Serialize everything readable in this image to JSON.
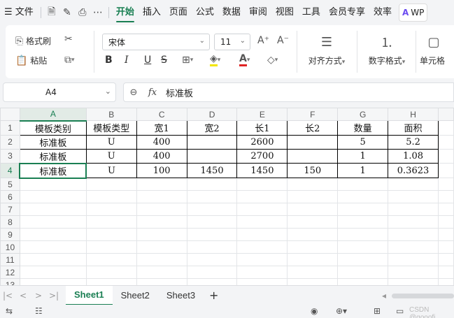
{
  "menu": {
    "file_label": "文件",
    "tabs": [
      "开始",
      "插入",
      "页面",
      "公式",
      "数据",
      "审阅",
      "视图",
      "工具",
      "会员专享",
      "效率"
    ],
    "active_tab": "开始",
    "wps_label": "WP"
  },
  "ribbon": {
    "format_painter": "格式刷",
    "paste": "粘贴",
    "font_name": "宋体",
    "font_size": "11",
    "align_label": "对齐方式",
    "number_label": "数字格式",
    "cell_label": "单元格"
  },
  "formula_bar": {
    "cell_ref": "A4",
    "fx": "fx",
    "value": "标准板"
  },
  "grid": {
    "columns": [
      "A",
      "B",
      "C",
      "D",
      "E",
      "F",
      "G",
      "H"
    ],
    "selected_column": "A",
    "selected_row": "4",
    "row_numbers": [
      "1",
      "2",
      "3",
      "4",
      "5",
      "6",
      "7",
      "8",
      "9",
      "10",
      "11",
      "12",
      "13"
    ],
    "rows": [
      [
        "模板类别",
        "模板类型",
        "宽1",
        "宽2",
        "长1",
        "长2",
        "数量",
        "面积"
      ],
      [
        "标准板",
        "U",
        "400",
        "",
        "2600",
        "",
        "5",
        "5.2"
      ],
      [
        "标准板",
        "U",
        "400",
        "",
        "2700",
        "",
        "1",
        "1.08"
      ],
      [
        "标准板",
        "U",
        "100",
        "1450",
        "1450",
        "150",
        "1",
        "0.3623"
      ]
    ]
  },
  "sheets": {
    "tabs": [
      "Sheet1",
      "Sheet2",
      "Sheet3"
    ],
    "active": "Sheet1",
    "add": "+"
  },
  "watermark": "CSDN @gooofi",
  "colors": {
    "accent": "#1a7f53"
  }
}
